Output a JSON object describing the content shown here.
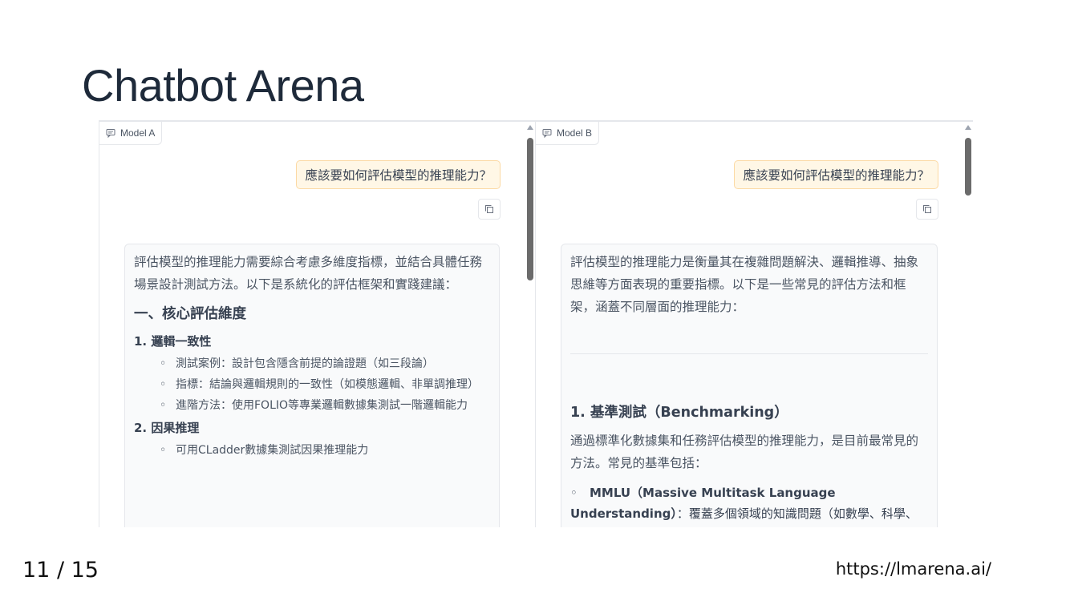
{
  "slide": {
    "title": "Chatbot Arena",
    "page_number": "11 / 15",
    "url": "https://lmarena.ai/"
  },
  "model_a": {
    "label": "Model A",
    "user_message": "應該要如何評估模型的推理能力？",
    "response": {
      "intro": "評估模型的推理能力需要綜合考慮多維度指標，並結合具體任務場景設計測試方法。以下是系統化的評估框架和實踐建議：",
      "section_heading": "一、核心評估維度",
      "item1_title": "1. 邏輯一致性",
      "item1_sub1": "測試案例：設計包含隱含前提的論證題（如三段論）",
      "item1_sub2": "指標：結論與邏輯規則的一致性（如模態邏輯、非單調推理）",
      "item1_sub3": "進階方法：使用FOLIO等專業邏輯數據集測試一階邏輯能力",
      "item2_title": "2. 因果推理",
      "item2_sub1": "可用CLadder數據集測試因果推理能力"
    }
  },
  "model_b": {
    "label": "Model B",
    "user_message": "應該要如何評估模型的推理能力？",
    "response": {
      "intro": "評估模型的推理能力是衡量其在複雜問題解決、邏輯推導、抽象思維等方面表現的重要指標。以下是一些常見的評估方法和框架，涵蓋不同層面的推理能力：",
      "section_heading": "1. 基準測試（Benchmarking）",
      "para": "通過標準化數據集和任務評估模型的推理能力，是目前最常見的方法。常見的基準包括：",
      "bullet1_bold": "MMLU（Massive Multitask Language Understanding）",
      "bullet1_rest": "：覆蓋多個領域的知識問題（如數學、科學、歷史）"
    }
  },
  "icons": {
    "model_label_icon": "chat-bubble-icon",
    "copy_icon": "copy-icon"
  }
}
